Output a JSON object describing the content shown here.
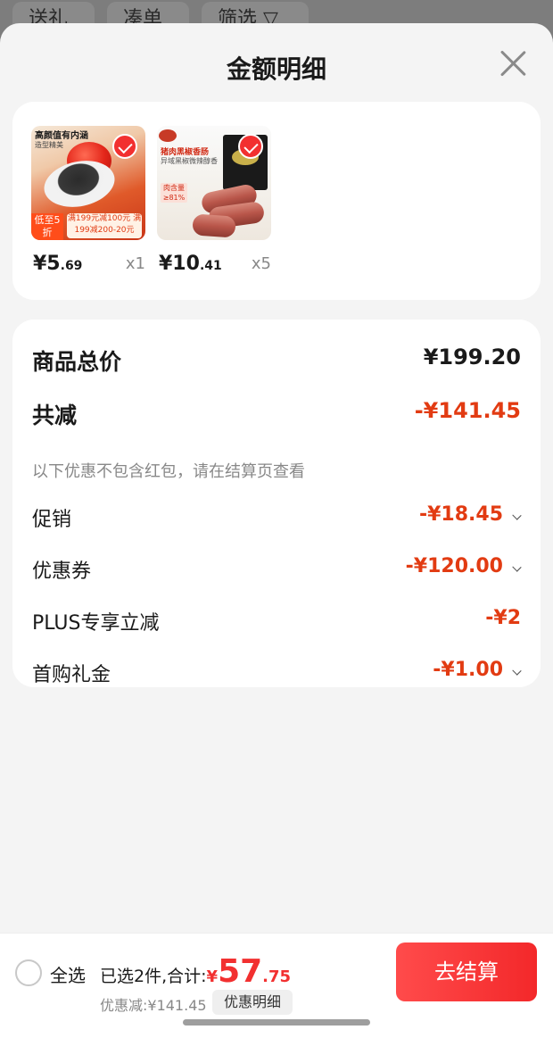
{
  "background_tabs": [
    "送礼",
    "凑单",
    "筛选 ▽"
  ],
  "sheet": {
    "title": "金额明细"
  },
  "products": [
    {
      "price_int": "¥5",
      "price_dec": ".69",
      "qty": "x1",
      "thumb_text": {
        "top": "高颜值有内涵",
        "top2": "造型精美",
        "badge": "低至5折",
        "promo": "满199元减100元 满199减200-20元"
      }
    },
    {
      "price_int": "¥10",
      "price_dec": ".41",
      "qty": "x5",
      "thumb_text": {
        "title": "猪肉黑椒香肠",
        "sub": "异域黑椒微辣醇香",
        "tag": "肉含量≥81%"
      }
    }
  ],
  "detail": {
    "total_label": "商品总价",
    "total_value": "¥199.20",
    "reduce_label": "共减",
    "reduce_value": "-¥141.45",
    "note": "以下优惠不包含红包，请在结算页查看",
    "items": [
      {
        "label": "促销",
        "value": "-¥18.45",
        "expandable": true
      },
      {
        "label": "优惠券",
        "value": "-¥120.00",
        "expandable": true
      },
      {
        "label": "PLUS专享立减",
        "value": "-¥2",
        "expandable": false
      },
      {
        "label": "首购礼金",
        "value": "-¥1.00",
        "expandable": true
      }
    ]
  },
  "bottom_bar": {
    "select_all": "全选",
    "summary_label": "已选2件,合计:",
    "currency": "¥",
    "total_int": "57",
    "total_dec": ".75",
    "saved": "优惠减:¥141.45",
    "detail_chip": "优惠明细",
    "checkout": "去结算"
  },
  "colors": {
    "accent_red": "#f23030",
    "discount_red": "#e23b12",
    "sheet_bg": "#f4f4f4"
  }
}
